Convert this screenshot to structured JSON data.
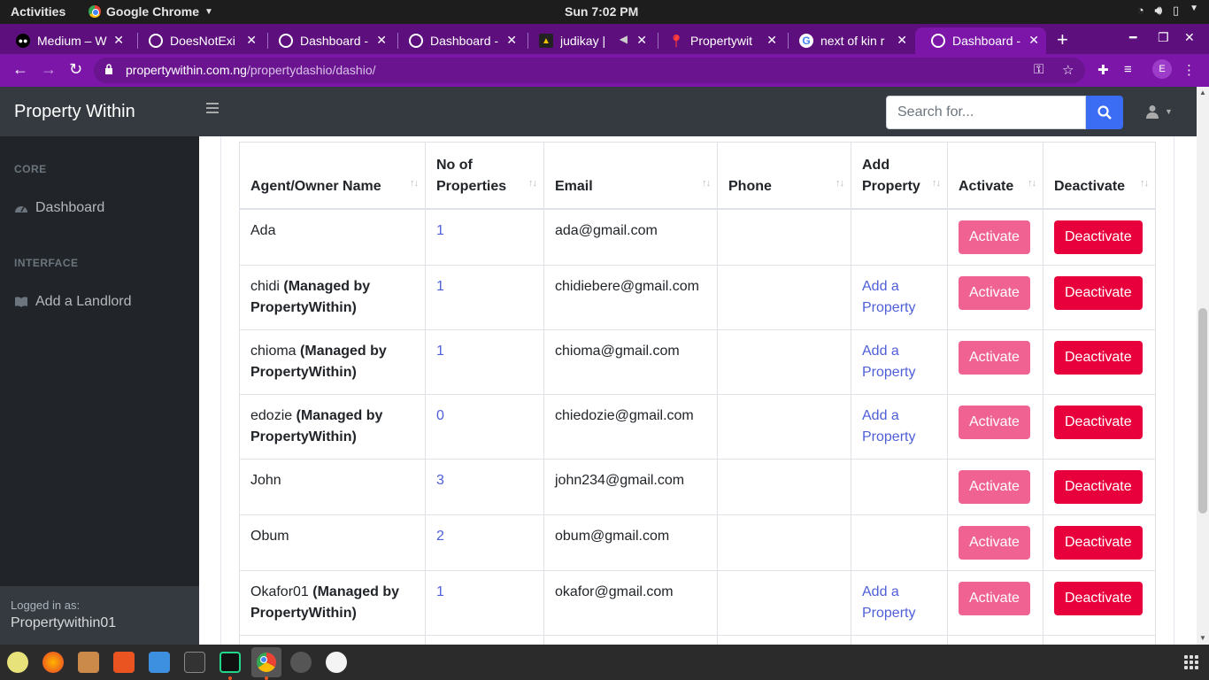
{
  "os_bar": {
    "activities": "Activities",
    "app_name": "Google Chrome",
    "clock": "Sun  7:02 PM"
  },
  "browser": {
    "tabs": [
      {
        "title": "Medium – W",
        "icon": "medium-icon"
      },
      {
        "title": "DoesNotExi",
        "icon": "globe-icon"
      },
      {
        "title": "Dashboard -",
        "icon": "globe-icon"
      },
      {
        "title": "Dashboard -",
        "icon": "globe-icon"
      },
      {
        "title": "judikay |",
        "icon": "audio-icon"
      },
      {
        "title": "Propertywit",
        "icon": "pin-icon"
      },
      {
        "title": "next of kin r",
        "icon": "google-icon"
      },
      {
        "title": "Dashboard -",
        "icon": "globe-icon",
        "active": true
      }
    ],
    "url_host": "propertywithin.com.ng",
    "url_path": "/propertydashio/dashio/",
    "profile_initial": "E",
    "theme_color": "#7b16a8"
  },
  "navbar": {
    "brand": "Property Within",
    "search_placeholder": "Search for..."
  },
  "sidebar": {
    "sections": [
      {
        "heading": "CORE",
        "items": [
          {
            "label": "Dashboard",
            "icon": "tachometer-icon"
          }
        ]
      },
      {
        "heading": "INTERFACE",
        "items": [
          {
            "label": "Add a Landlord",
            "icon": "book-icon"
          }
        ]
      }
    ],
    "footer_label": "Logged in as:",
    "footer_user": "Propertywithin01"
  },
  "table": {
    "headers": [
      "Agent/Owner Name",
      "No of Properties",
      "Email",
      "Phone",
      "Add Property",
      "Activate",
      "Deactivate"
    ],
    "managed_suffix": "(Managed by PropertyWithin)",
    "add_property_label": "Add a Property",
    "activate_label": "Activate",
    "deactivate_label": "Deactivate",
    "rows": [
      {
        "name": "Ada",
        "managed": false,
        "count": "1",
        "email": "ada@gmail.com",
        "phone": ""
      },
      {
        "name": "chidi",
        "managed": true,
        "count": "1",
        "email": "chidiebere@gmail.com",
        "phone": ""
      },
      {
        "name": "chioma",
        "managed": true,
        "count": "1",
        "email": "chioma@gmail.com",
        "phone": ""
      },
      {
        "name": "edozie",
        "managed": true,
        "count": "0",
        "email": "chiedozie@gmail.com",
        "phone": ""
      },
      {
        "name": "John",
        "managed": false,
        "count": "3",
        "email": "john234@gmail.com",
        "phone": ""
      },
      {
        "name": "Obum",
        "managed": false,
        "count": "2",
        "email": "obum@gmail.com",
        "phone": ""
      },
      {
        "name": "Okafor01",
        "managed": true,
        "count": "1",
        "email": "okafor@gmail.com",
        "phone": ""
      }
    ]
  },
  "colors": {
    "activate": "#f06292",
    "deactivate": "#e8003d",
    "link": "#4e5fd8",
    "search_button": "#3a6cf4"
  }
}
